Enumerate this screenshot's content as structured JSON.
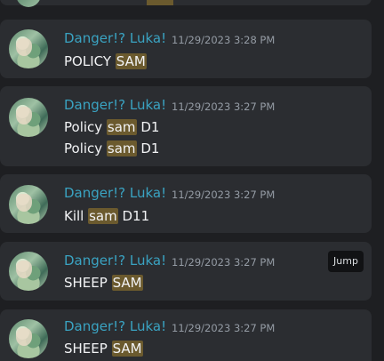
{
  "results": [
    {
      "author": "Danger!? Luka!",
      "timestamp": "11/29/2023 3:28 PM",
      "lines": [
        {
          "before": "",
          "highlight": "POLICY",
          "after": ""
        }
      ],
      "line_override": {
        "before": "POLICY ",
        "highlight": "SAM",
        "after": ""
      }
    },
    {
      "author": "Danger!? Luka!",
      "timestamp": "11/29/2023 3:27 PM",
      "line1": {
        "before": "Policy ",
        "highlight": "sam",
        "after": " D1"
      },
      "line2": {
        "before": "Policy ",
        "highlight": "sam",
        "after": " D1"
      }
    },
    {
      "author": "Danger!? Luka!",
      "timestamp": "11/29/2023 3:27 PM",
      "line1": {
        "before": "Kill ",
        "highlight": "sam",
        "after": " D11"
      }
    },
    {
      "author": "Danger!? Luka!",
      "timestamp": "11/29/2023 3:27 PM",
      "line1": {
        "before": "SHEEP ",
        "highlight": "SAM",
        "after": ""
      },
      "jump_label": "Jump"
    },
    {
      "author": "Danger!? Luka!",
      "timestamp": "11/29/2023 3:27 PM",
      "line1": {
        "before": "SHEEP ",
        "highlight": "SAM",
        "after": ""
      }
    }
  ],
  "colors": {
    "background": "#1e1f22",
    "card": "#2b2d31",
    "author": "#3aa3c2",
    "timestamp": "#949ba4",
    "text": "#f2f3f5",
    "highlight": "#6b5a2e"
  },
  "icons": {
    "avatar": "user-avatar-image"
  }
}
